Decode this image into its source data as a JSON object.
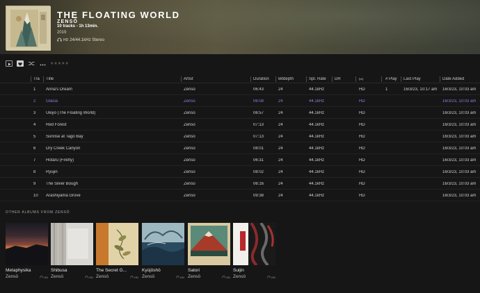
{
  "album": {
    "title": "THE FLOATING WORLD",
    "artist": "ZENSŌ",
    "tracks_info": "10 tracks - 1h 13min.",
    "year": "2019",
    "hd": "HD",
    "format": "24/44.1kHz Stereo"
  },
  "toolbar": {
    "stars": "★★★★★"
  },
  "columns": [
    "Tra",
    "Title",
    "Artist",
    "Duration",
    "Bitdepth",
    "Spl. Rate",
    "DR",
    "# Play",
    "Last Play",
    "Date Added"
  ],
  "tracks": [
    {
      "no": "1",
      "title": "Anna's Dream",
      "artist": "Zensō",
      "duration": "06:43",
      "bitdepth": "24",
      "rate": "44.1kHz",
      "hd": "HD",
      "plays": "1",
      "last": "16/3/23, 10:17 am",
      "added": "16/3/23, 10:03 am",
      "selected": false
    },
    {
      "no": "2",
      "title": "Glacia",
      "artist": "Zensō",
      "duration": "06:08",
      "bitdepth": "24",
      "rate": "44.1kHz",
      "hd": "HD",
      "plays": "",
      "last": "",
      "added": "16/3/23, 10:03 am",
      "selected": true
    },
    {
      "no": "3",
      "title": "Ukiyo (The Floating World)",
      "artist": "Zensō",
      "duration": "06:57",
      "bitdepth": "24",
      "rate": "44.1kHz",
      "hd": "HD",
      "plays": "",
      "last": "",
      "added": "16/3/23, 10:03 am",
      "selected": false
    },
    {
      "no": "4",
      "title": "Red Forest",
      "artist": "Zensō",
      "duration": "07:13",
      "bitdepth": "24",
      "rate": "44.1kHz",
      "hd": "HD",
      "plays": "",
      "last": "",
      "added": "16/3/23, 10:03 am",
      "selected": false
    },
    {
      "no": "5",
      "title": "Sunrise at Tago Bay",
      "artist": "Zensō",
      "duration": "07:13",
      "bitdepth": "24",
      "rate": "44.1kHz",
      "hd": "HD",
      "plays": "",
      "last": "",
      "added": "16/3/23, 10:03 am",
      "selected": false
    },
    {
      "no": "6",
      "title": "Dry Creek Canyon",
      "artist": "Zensō",
      "duration": "08:01",
      "bitdepth": "24",
      "rate": "44.1kHz",
      "hd": "HD",
      "plays": "",
      "last": "",
      "added": "16/3/23, 10:03 am",
      "selected": false
    },
    {
      "no": "7",
      "title": "Hotaru (Firefly)",
      "artist": "Zensō",
      "duration": "06:31",
      "bitdepth": "24",
      "rate": "44.1kHz",
      "hd": "HD",
      "plays": "",
      "last": "",
      "added": "16/3/23, 10:03 am",
      "selected": false
    },
    {
      "no": "8",
      "title": "Ryūjin",
      "artist": "Zensō",
      "duration": "08:02",
      "bitdepth": "24",
      "rate": "44.1kHz",
      "hd": "HD",
      "plays": "",
      "last": "",
      "added": "16/3/23, 10:03 am",
      "selected": false
    },
    {
      "no": "9",
      "title": "The Silver Bough",
      "artist": "Zensō",
      "duration": "06:16",
      "bitdepth": "24",
      "rate": "44.1kHz",
      "hd": "HD",
      "plays": "",
      "last": "",
      "added": "16/3/23, 10:03 am",
      "selected": false
    },
    {
      "no": "10",
      "title": "Arashiyama Grove",
      "artist": "Zensō",
      "duration": "09:38",
      "bitdepth": "24",
      "rate": "44.1kHz",
      "hd": "HD",
      "plays": "",
      "last": "",
      "added": "16/3/23, 10:03 am",
      "selected": false
    }
  ],
  "other_albums": {
    "title": "OTHER ALBUMS FROM ZENSŌ",
    "items": [
      {
        "name": "Metaphysika",
        "artist": "Zensō",
        "hd": "HD"
      },
      {
        "name": "Shibusa",
        "artist": "Zensō",
        "hd": "HD"
      },
      {
        "name": "The Secret G...",
        "artist": "Zensō",
        "hd": "HD"
      },
      {
        "name": "Kyūjōshō",
        "artist": "Zensō",
        "hd": "HD"
      },
      {
        "name": "Satori",
        "artist": "Zensō",
        "hd": "HD"
      },
      {
        "name": "Suijin",
        "artist": "Zensō",
        "hd": "HD"
      }
    ]
  },
  "colors": {
    "selected_track": "#8b7fe0",
    "background": "#161616"
  }
}
